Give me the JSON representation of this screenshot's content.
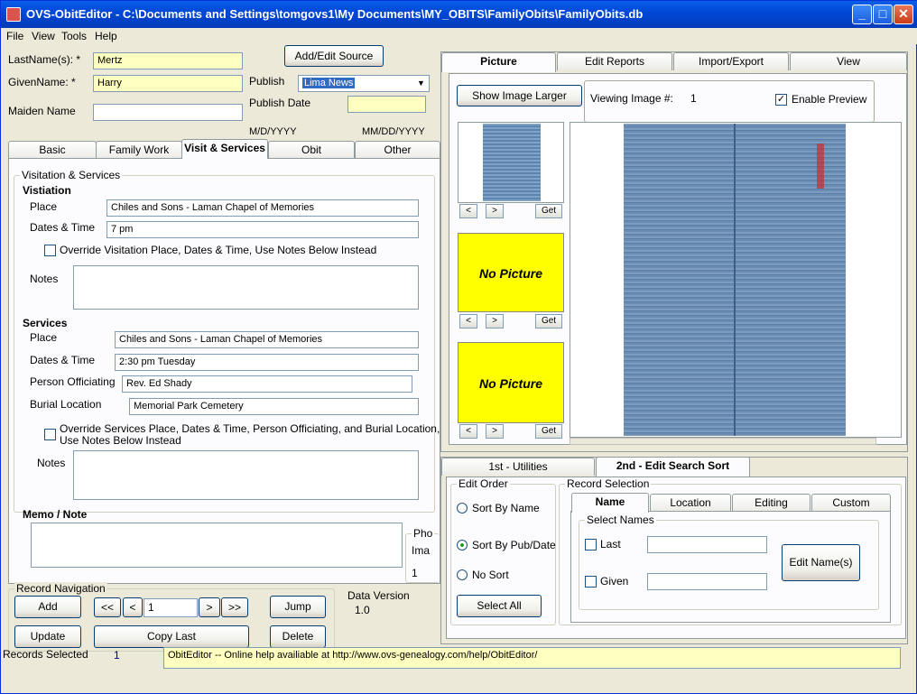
{
  "window": {
    "title": "OVS-ObitEditor - C:\\Documents and Settings\\tomgovs1\\My Documents\\MY_OBITS\\FamilyObits\\FamilyObits.db",
    "min": "_",
    "max": "□",
    "close": "✕"
  },
  "menu": [
    "File",
    "View",
    "Tools",
    "Help"
  ],
  "header": {
    "lastname_label": "LastName(s): *",
    "lastname_value": "Mertz",
    "givenname_label": "GivenName: *",
    "givenname_value": "Harry",
    "maiden_label": "Maiden Name",
    "maiden_value": "",
    "add_source_button": "Add/Edit Source",
    "publish_label": "Publish",
    "publish_value": "Lima News",
    "publish_date_label": "Publish Date",
    "publish_date_value": "",
    "date_hint_1": "M/D/YYYY",
    "date_hint_2": "MM/DD/YYYY"
  },
  "left_tabs": [
    "Basic",
    "Family Work",
    "Visit & Services",
    "Obit",
    "Other"
  ],
  "visit": {
    "group_title": "Visitation & Services",
    "visitation_heading": "Vistiation",
    "place_label": "Place",
    "place_value": "Chiles and Sons - Laman Chapel of Memories",
    "dates_label": "Dates & Time",
    "dates_value": "7 pm",
    "override_visit": "Override Visitation Place, Dates & Time, Use Notes Below Instead",
    "notes_label": "Notes",
    "services_heading": "Services",
    "svc_place_label": "Place",
    "svc_place_value": "Chiles and Sons - Laman Chapel of Memories",
    "svc_dates_label": "Dates & Time",
    "svc_dates_value": "2:30 pm Tuesday",
    "officiating_label": "Person Officiating",
    "officiating_value": "Rev. Ed Shady",
    "burial_label": "Burial Location",
    "burial_value": "Memorial Park Cemetery",
    "override_services_1": "Override Services Place, Dates & Time, Person Officiating, and Burial Location,",
    "override_services_2": "Use Notes Below Instead",
    "svc_notes_label": "Notes",
    "memo_label": "Memo / Note",
    "pho_label": "Pho",
    "ima_label": "Ima",
    "pho_value": "1"
  },
  "nav": {
    "group_title": "Record Navigation",
    "add": "Add",
    "first": "<<",
    "prev": "<",
    "record": "1",
    "next": ">",
    "last": ">>",
    "jump": "Jump",
    "update": "Update",
    "copy_last": "Copy Last",
    "delete": "Delete",
    "data_version_label": "Data Version",
    "data_version_value": "1.0"
  },
  "right_tabs": [
    "Picture",
    "Edit Reports",
    "Import/Export",
    "View"
  ],
  "picture": {
    "show_larger": "Show Image Larger",
    "viewing_label": "Viewing Image #:",
    "viewing_value": "1",
    "enable_preview": "Enable Preview",
    "no_picture": "No Picture",
    "get": "Get",
    "prev": "<",
    "next": ">"
  },
  "bottom_tabs": [
    "1st - Utilities",
    "2nd - Edit Search Sort"
  ],
  "sort": {
    "edit_order_title": "Edit Order",
    "sort_name": "Sort By Name",
    "sort_pub": "Sort By Pub/Date",
    "no_sort": "No Sort",
    "select_all": "Select All",
    "record_selection_title": "Record Selection",
    "tabs": [
      "Name",
      "Location",
      "Editing",
      "Custom"
    ],
    "select_names_title": "Select Names",
    "last_label": "Last",
    "given_label": "Given",
    "edit_names_button": "Edit Name(s)"
  },
  "status": {
    "records_selected_label": "Records Selected",
    "records_selected_value": "1",
    "help_text": "ObitEditor -- Online help availiable at http://www.ovs-genealogy.com/help/ObitEditor/"
  }
}
